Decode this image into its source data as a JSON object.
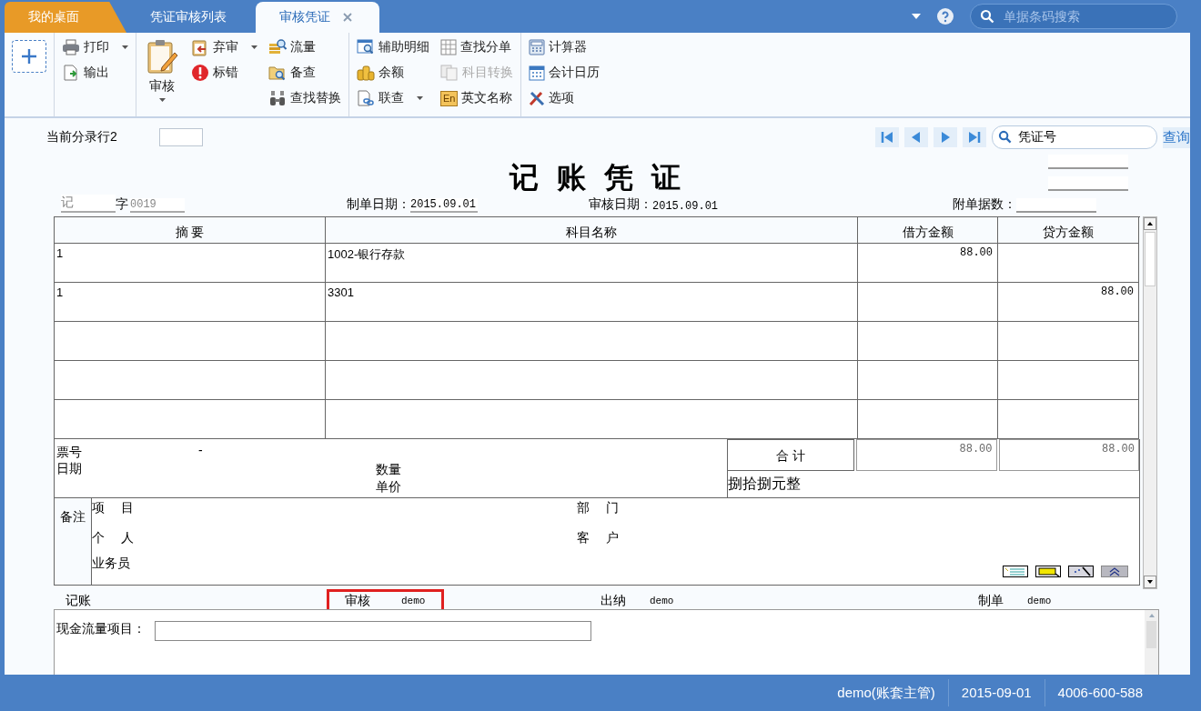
{
  "tabs": [
    {
      "label": "我的桌面",
      "kind": "home",
      "selected": false,
      "closable": false
    },
    {
      "label": "凭证审核列表",
      "kind": "page",
      "selected": false,
      "closable": false
    },
    {
      "label": "审核凭证",
      "kind": "page",
      "selected": true,
      "closable": true
    }
  ],
  "barcode_search": {
    "placeholder": "单据条码搜索"
  },
  "toolbar": {
    "groups": [
      {
        "columns": [
          [
            {
              "kind": "add",
              "menu": false,
              "disabled": false
            }
          ]
        ]
      },
      {
        "columns": [
          [
            {
              "kind": "small",
              "label": "打印",
              "menu": true,
              "disabled": false
            },
            {
              "kind": "small",
              "label": "输出",
              "menu": false,
              "disabled": false
            }
          ]
        ]
      },
      {
        "columns": [
          [
            {
              "kind": "large",
              "label": "审核",
              "menu": true,
              "disabled": false
            }
          ],
          [
            {
              "kind": "small",
              "label": "弃审",
              "menu": true,
              "disabled": false
            },
            {
              "kind": "small",
              "label": "标错",
              "menu": false,
              "disabled": false
            }
          ],
          [
            {
              "kind": "small",
              "label": "流量",
              "menu": false,
              "disabled": false
            },
            {
              "kind": "small",
              "label": "备查",
              "menu": false,
              "disabled": false
            },
            {
              "kind": "small",
              "label": "查找替换",
              "menu": false,
              "disabled": false
            }
          ]
        ]
      },
      {
        "columns": [
          [
            {
              "kind": "small",
              "label": "辅助明细",
              "menu": false,
              "disabled": false
            },
            {
              "kind": "small",
              "label": "余额",
              "menu": false,
              "disabled": false
            },
            {
              "kind": "small",
              "label": "联查",
              "menu": true,
              "disabled": false
            }
          ],
          [
            {
              "kind": "small",
              "label": "查找分单",
              "menu": false,
              "disabled": false
            },
            {
              "kind": "small",
              "label": "科目转换",
              "menu": false,
              "disabled": true
            },
            {
              "kind": "small",
              "label": "英文名称",
              "menu": false,
              "disabled": false,
              "icon_text": "En"
            }
          ]
        ]
      },
      {
        "columns": [
          [
            {
              "kind": "small",
              "label": "计算器",
              "menu": false,
              "disabled": false
            },
            {
              "kind": "small",
              "label": "会计日历",
              "menu": false,
              "disabled": false
            },
            {
              "kind": "small",
              "label": "选项",
              "menu": false,
              "disabled": false
            }
          ]
        ]
      }
    ]
  },
  "voucher": {
    "current_row": {
      "label": "当前分录行2"
    },
    "search": {
      "value": "凭证号"
    },
    "query_link": "查询",
    "title": "记 账 凭 证",
    "type": "记",
    "type_suffix": "字",
    "number": "0019",
    "made_date": {
      "label": "制单日期：",
      "value": "2015.09.01"
    },
    "audit_date": {
      "label": "审核日期：",
      "value": "2015.09.01"
    },
    "attachments": {
      "label": "附单据数："
    },
    "table": {
      "columns": [
        "摘 要",
        "科目名称",
        "借方金额",
        "贷方金额"
      ],
      "rows": [
        {
          "summary": "1",
          "account": "1002-银行存款",
          "debit": "88.00"
        },
        {
          "summary": "1",
          "account": "3301",
          "credit": "88.00"
        },
        {},
        {},
        {}
      ]
    },
    "details": {
      "ticket_label": "票号",
      "ticket_value": "-",
      "date_label": "日期",
      "quantity_label": "数量",
      "price_label": "单价"
    },
    "total": {
      "label": "合 计",
      "debit": "88.00",
      "credit": "88.00",
      "in_words": "捌拾捌元整"
    },
    "remarks": {
      "label": "备注",
      "fields": [
        {
          "label": "项 目"
        },
        {
          "label": "部 门"
        },
        {
          "label": "个 人"
        },
        {
          "label": "客 户"
        },
        {
          "label": "业务员"
        }
      ]
    },
    "signatures": [
      {
        "label": "记账",
        "highlighted": false
      },
      {
        "label": "审核",
        "value": "demo",
        "highlighted": true
      },
      {
        "label": "出纳",
        "value": "demo",
        "highlighted": false
      },
      {
        "label": "制单",
        "value": "demo",
        "highlighted": false
      }
    ],
    "cash_flow": {
      "label": "现金流量项目："
    }
  },
  "status_bar": [
    "demo(账套主管)",
    "2015-09-01",
    "4006-600-588"
  ]
}
